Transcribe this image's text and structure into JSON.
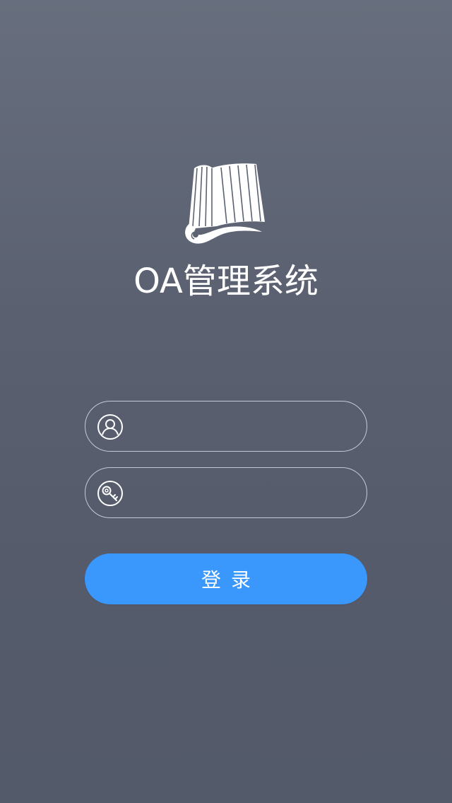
{
  "app": {
    "title": "OA管理系统",
    "logo_icon": "book-scroll-icon"
  },
  "form": {
    "username": {
      "icon": "user-icon",
      "value": "",
      "placeholder": ""
    },
    "password": {
      "icon": "key-icon",
      "value": "",
      "placeholder": ""
    },
    "login_label": "登录"
  },
  "colors": {
    "background_top": "#676e7d",
    "background_bottom": "#535a6a",
    "accent": "#3a97fb",
    "field_border": "#ebeef5",
    "text": "#ffffff"
  }
}
